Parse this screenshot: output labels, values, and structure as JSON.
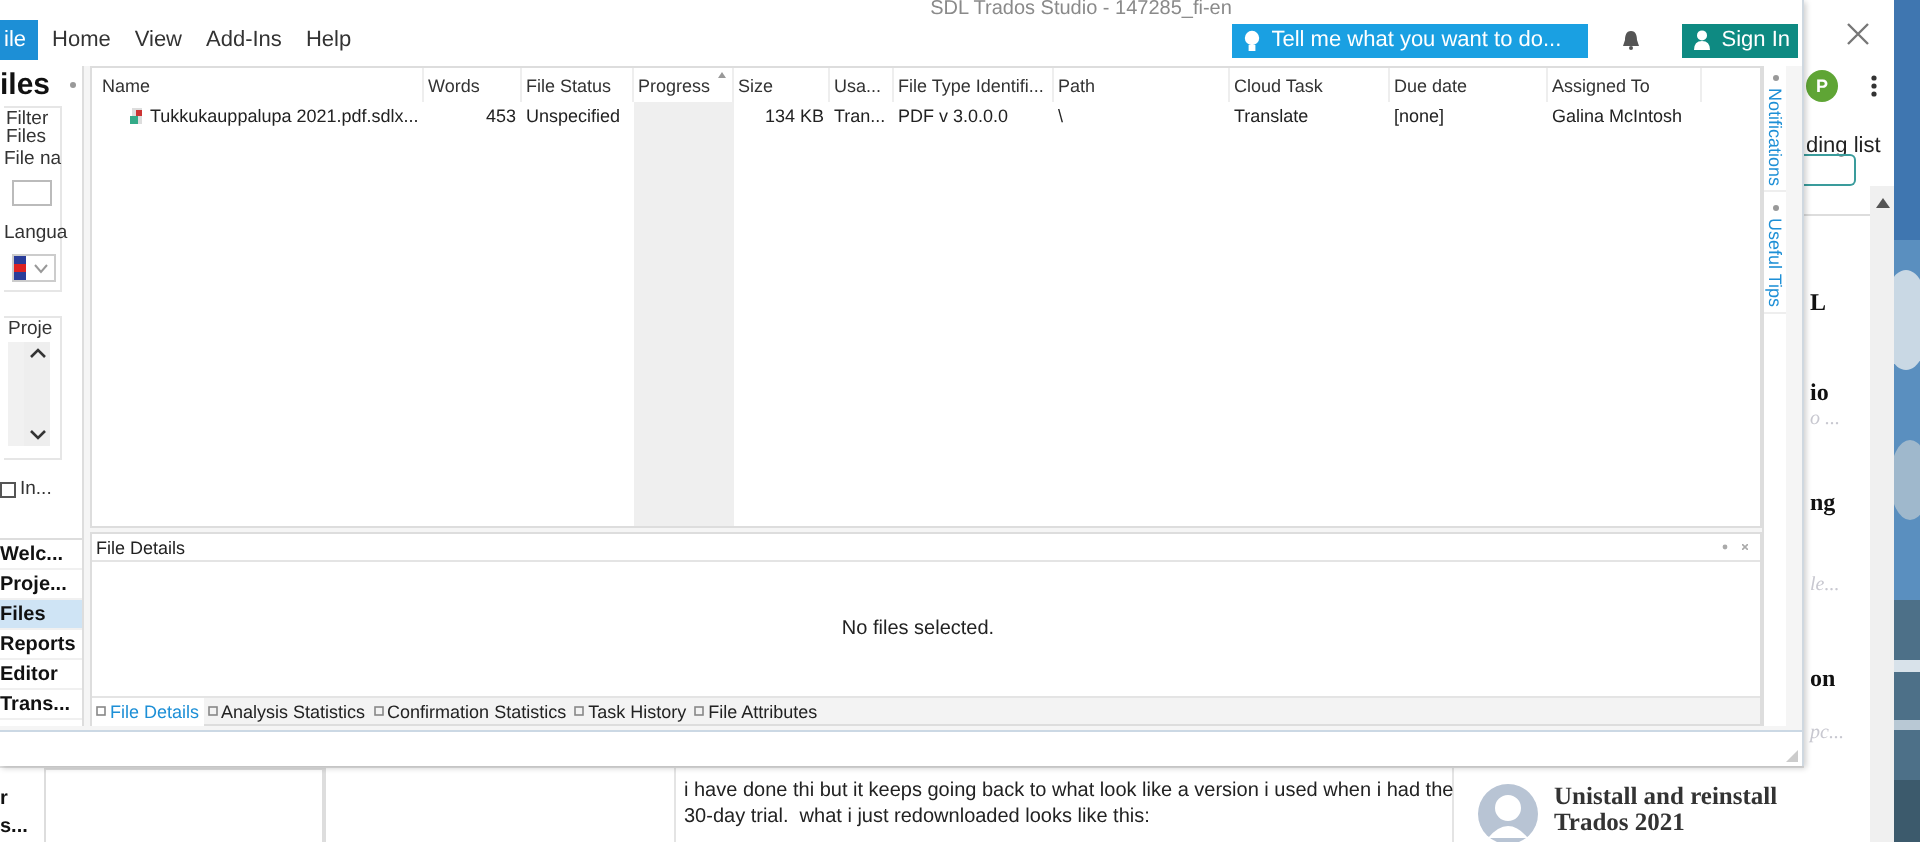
{
  "browser": {
    "avatar_initial": "P",
    "reading_list": "ding list",
    "fragments": [
      {
        "text": "L",
        "kind": "bold"
      },
      {
        "text": "io",
        "kind": "bold"
      },
      {
        "text": "o ...",
        "kind": "faint"
      },
      {
        "text": "ng",
        "kind": "bold"
      },
      {
        "text": "le...",
        "kind": "faint"
      },
      {
        "text": "on",
        "kind": "bold"
      },
      {
        "text": "pc...",
        "kind": "faint"
      }
    ],
    "behind_items": [
      "r",
      "s..."
    ],
    "comment": "i have done thi but it keeps going back to what look like a version i used when i had the\n30-day trial.  what i just redownloaded looks like this:",
    "related_title": "Unistall and reinstall Trados 2021"
  },
  "window": {
    "title": "SDL Trados Studio - 147285_fi-en",
    "menu": [
      {
        "label": "ile",
        "kind": "file"
      },
      {
        "label": "Home",
        "kind": "tab"
      },
      {
        "label": "View",
        "kind": "tab"
      },
      {
        "label": "Add-Ins",
        "kind": "tab"
      },
      {
        "label": "Help",
        "kind": "tab"
      }
    ],
    "tell_me": {
      "placeholder": "Tell me what you want to do..."
    },
    "sign_in": "Sign In",
    "nav_panel": {
      "title": "iles",
      "filter_group": "Filter Files",
      "file_name_label": "File na",
      "language_label": "Langua",
      "project_group": "Proje",
      "checkbox": {
        "label": "In...",
        "checked": false
      }
    },
    "nav_items": [
      {
        "label": "Welc...",
        "selected": false
      },
      {
        "label": "Proje...",
        "selected": false
      },
      {
        "label": "Files",
        "selected": true
      },
      {
        "label": "Reports",
        "selected": false
      },
      {
        "label": "Editor",
        "selected": false
      },
      {
        "label": "Trans...",
        "selected": false
      }
    ],
    "table": {
      "columns": [
        "Name",
        "Words",
        "File Status",
        "Progress",
        "Size",
        "Usa...",
        "File Type Identifi...",
        "Path",
        "Cloud Task",
        "Due date",
        "Assigned To"
      ],
      "rows": [
        {
          "cells": [
            "Tukkukauppalupa 2021.pdf.sdlx...",
            "453",
            "Unspecified",
            "",
            "134 KB",
            "Tran...",
            "PDF v 3.0.0.0",
            "\\",
            "Translate",
            "[none]",
            "Galina McIntosh"
          ]
        }
      ]
    },
    "details": {
      "title": "File Details",
      "message": "No files selected."
    },
    "detail_tabs": [
      {
        "label": "File Details",
        "selected": true
      },
      {
        "label": "Analysis Statistics",
        "selected": false
      },
      {
        "label": "Confirmation Statistics",
        "selected": false
      },
      {
        "label": "Task History",
        "selected": false
      },
      {
        "label": "File Attributes",
        "selected": false
      }
    ],
    "side_tabs": [
      "Notifications",
      "Useful Tips"
    ]
  }
}
